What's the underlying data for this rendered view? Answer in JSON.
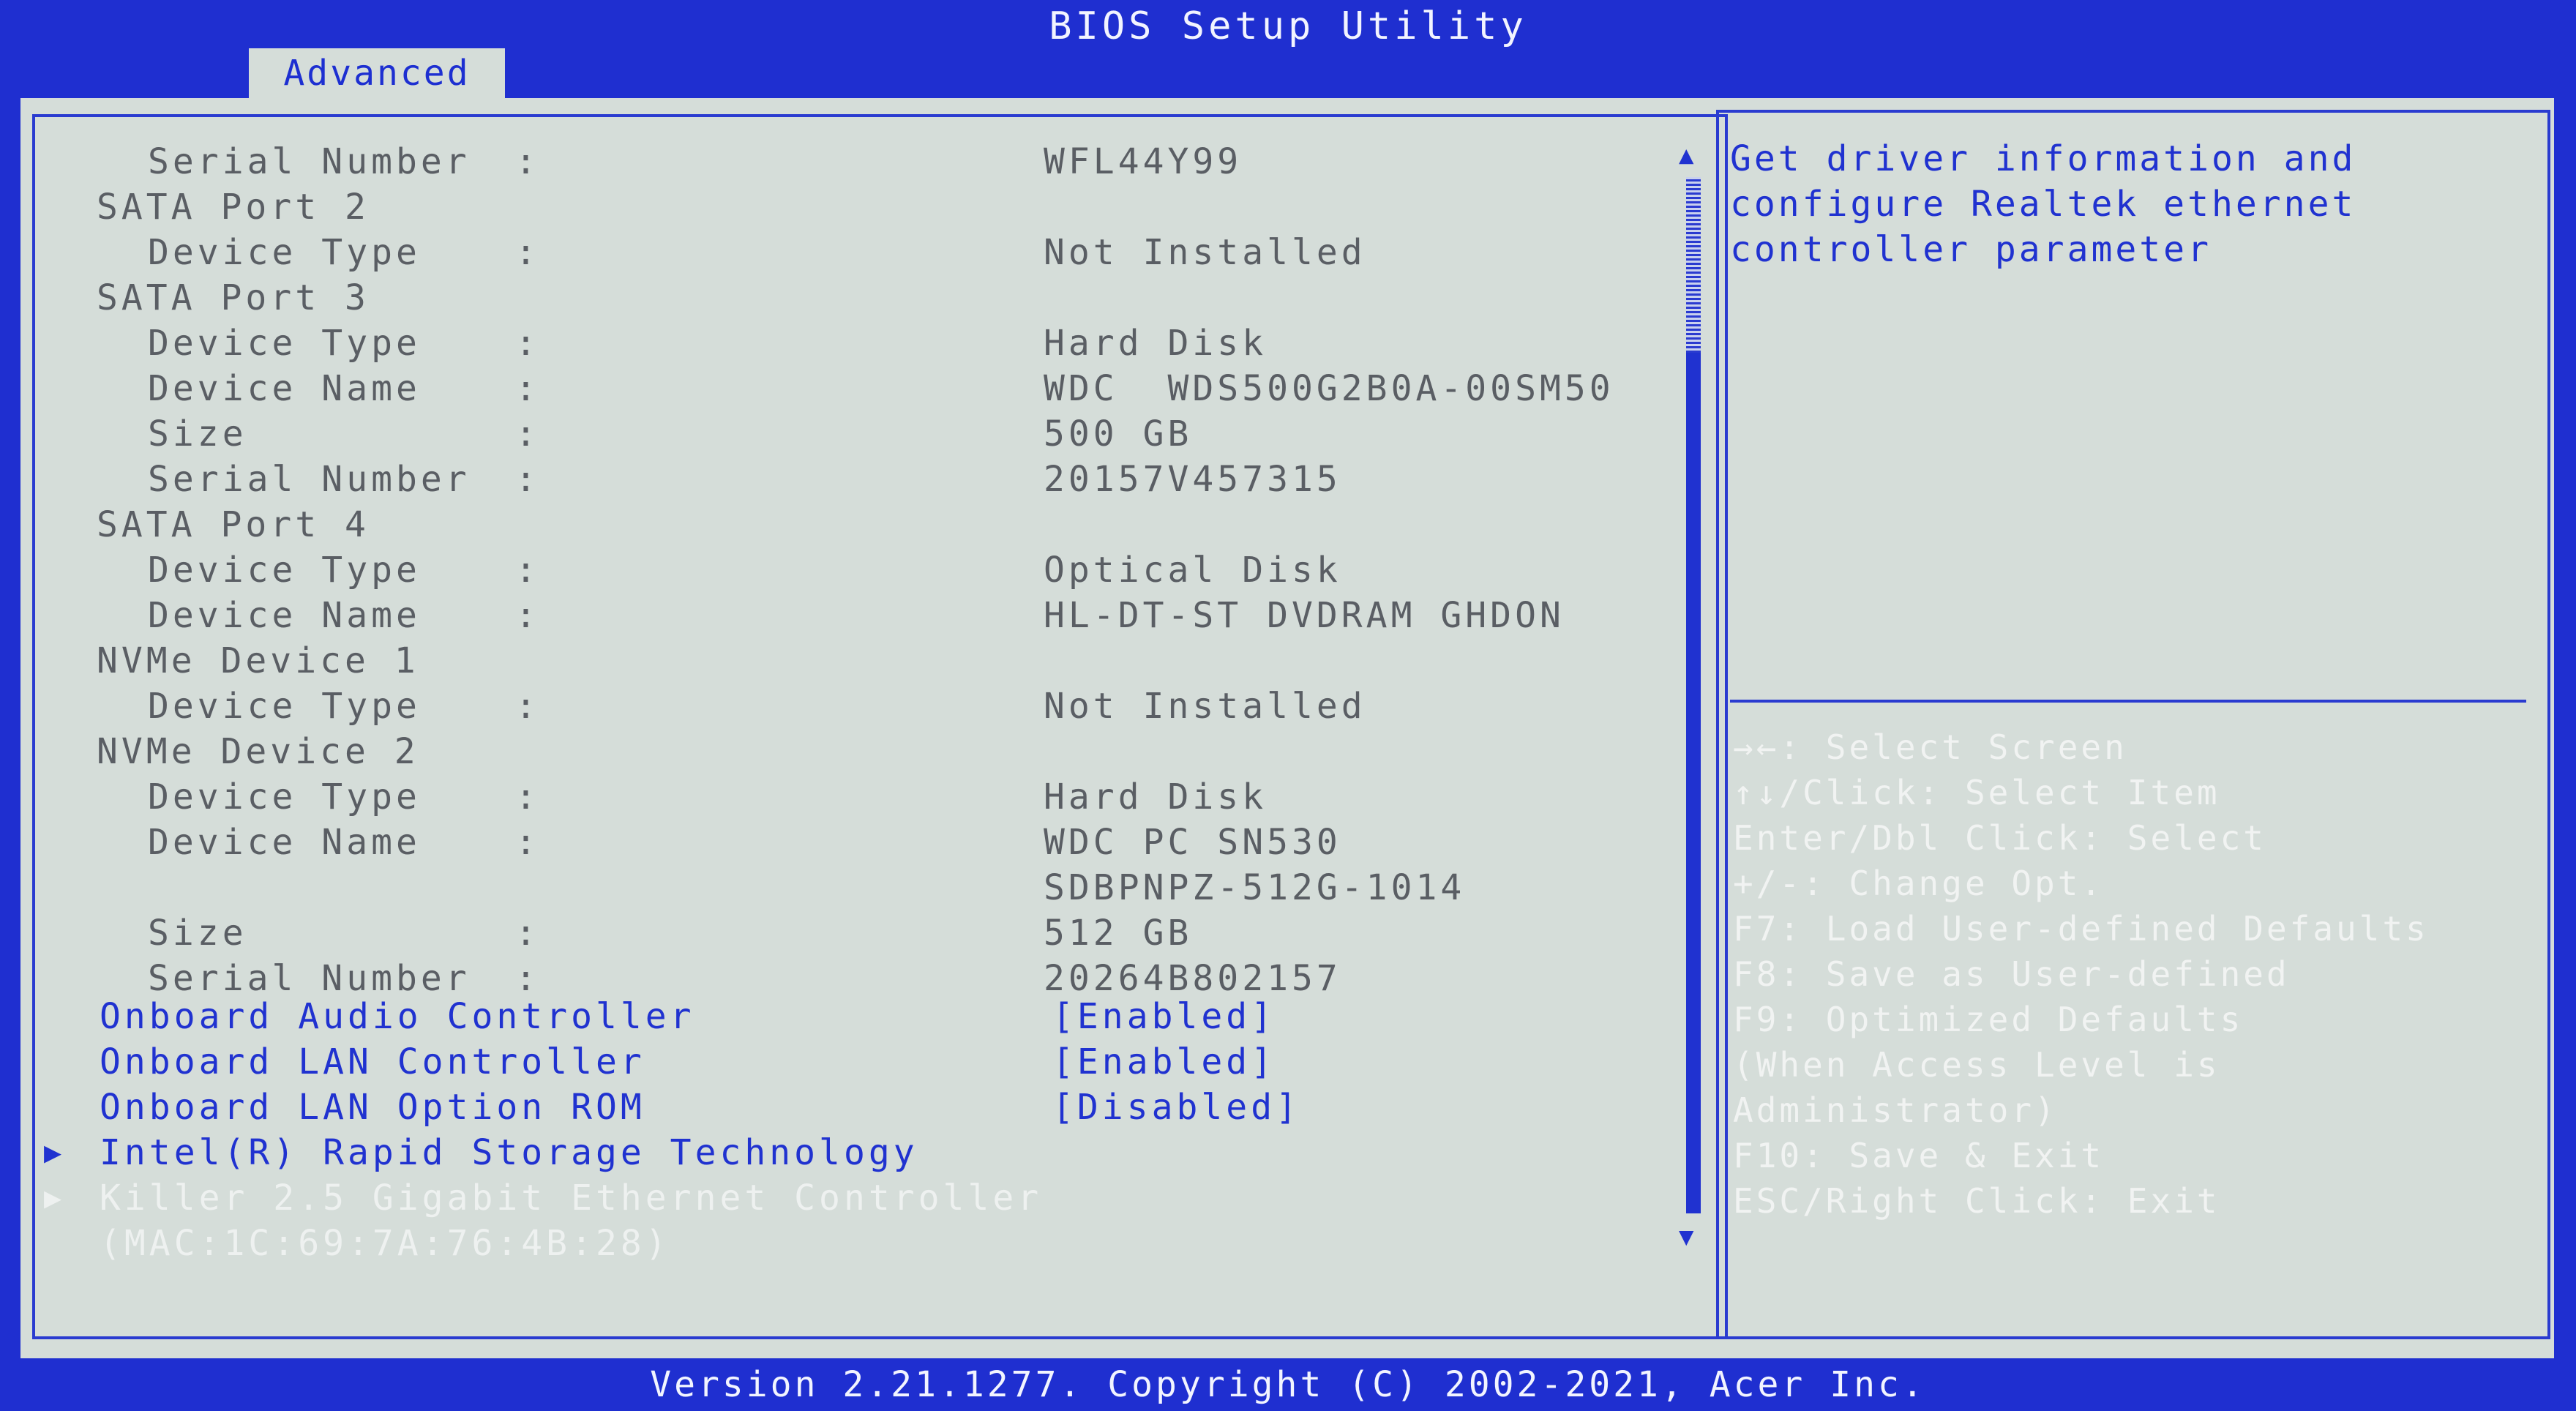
{
  "app": {
    "title": "BIOS Setup Utility"
  },
  "tabs": [
    {
      "label": "Advanced",
      "active": true
    }
  ],
  "main_rows": [
    {
      "label": "Serial Number",
      "indent": 2,
      "colon": ":",
      "value": "WFL44Y99"
    },
    {
      "label": "SATA Port 2",
      "indent": 1
    },
    {
      "label": "Device Type",
      "indent": 2,
      "colon": ":",
      "value": "Not Installed"
    },
    {
      "label": "SATA Port 3",
      "indent": 1
    },
    {
      "label": "Device Type",
      "indent": 2,
      "colon": ":",
      "value": "Hard Disk"
    },
    {
      "label": "Device Name",
      "indent": 2,
      "colon": ":",
      "value": "WDC  WDS500G2B0A-00SM50"
    },
    {
      "label": "Size",
      "indent": 2,
      "colon": ":",
      "value": "500 GB"
    },
    {
      "label": "Serial Number",
      "indent": 2,
      "colon": ":",
      "value": "20157V457315"
    },
    {
      "label": "SATA Port 4",
      "indent": 1
    },
    {
      "label": "Device Type",
      "indent": 2,
      "colon": ":",
      "value": "Optical Disk"
    },
    {
      "label": "Device Name",
      "indent": 2,
      "colon": ":",
      "value": "HL-DT-ST DVDRAM GHDON"
    },
    {
      "label": "NVMe Device 1",
      "indent": 1
    },
    {
      "label": "Device Type",
      "indent": 2,
      "colon": ":",
      "value": "Not Installed"
    },
    {
      "label": "NVMe Device 2",
      "indent": 1
    },
    {
      "label": "Device Type",
      "indent": 2,
      "colon": ":",
      "value": "Hard Disk"
    },
    {
      "label": "Device Name",
      "indent": 2,
      "colon": ":",
      "value": "WDC PC SN530"
    },
    {
      "label": "",
      "indent": 2,
      "value": "SDBPNPZ-512G-1014"
    },
    {
      "label": "Size",
      "indent": 2,
      "colon": ":",
      "value": "512 GB"
    },
    {
      "label": "Serial Number",
      "indent": 2,
      "colon": ":",
      "value": "20264B802157"
    }
  ],
  "options": [
    {
      "label": "Onboard Audio Controller",
      "value": "[Enabled]"
    },
    {
      "label": "Onboard LAN Controller",
      "value": "[Enabled]"
    },
    {
      "label": "Onboard LAN Option ROM",
      "value": "[Disabled]"
    }
  ],
  "submenus": [
    {
      "label": "Intel(R) Rapid Storage Technology",
      "arrow": "▶",
      "selected": false
    },
    {
      "label": "Killer 2.5 Gigabit Ethernet Controller",
      "arrow": "▶",
      "selected": true,
      "sublabel": "(MAC:1C:69:7A:76:4B:28)"
    }
  ],
  "scrollbar": {
    "up": "▲",
    "down": "▼"
  },
  "help_lines": [
    "Get driver information and",
    "configure Realtek ethernet",
    "controller parameter"
  ],
  "key_help": [
    "→←: Select Screen",
    "↑↓/Click: Select Item",
    "Enter/Dbl Click: Select",
    "+/-: Change Opt.",
    "F7: Load User-defined Defaults",
    "F8: Save as User-defined",
    "F9: Optimized Defaults",
    "(When Access Level is",
    "Administrator)",
    "F10: Save & Exit",
    "ESC/Right Click: Exit"
  ],
  "footer": {
    "text": "Version 2.21.1277. Copyright (C) 2002-2021, Acer Inc."
  },
  "colors": {
    "frame_blue": "#1f2fd0",
    "panel_bg": "#d5ddd9",
    "text_gray": "#5a5e64",
    "option_blue": "#2032d0"
  }
}
